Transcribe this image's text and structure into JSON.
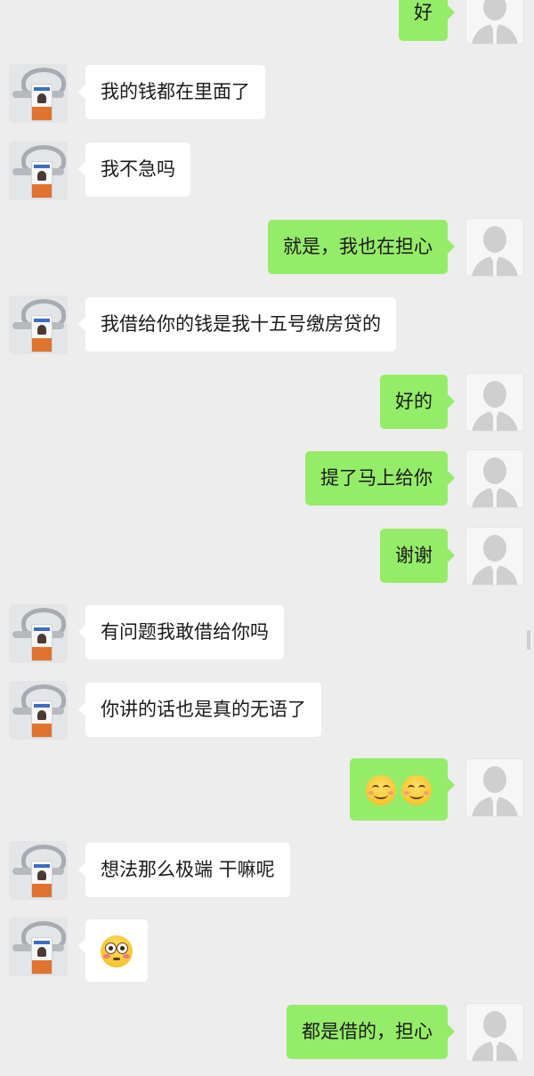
{
  "conversation": {
    "messages": [
      {
        "side": "right",
        "text": "好"
      },
      {
        "side": "left",
        "text": "我的钱都在里面了"
      },
      {
        "side": "left",
        "text": "我不急吗"
      },
      {
        "side": "right",
        "text": "就是，我也在担心"
      },
      {
        "side": "left",
        "text": "我借给你的钱是我十五号缴房贷的"
      },
      {
        "side": "right",
        "text": "好的"
      },
      {
        "side": "right",
        "text": "提了马上给你"
      },
      {
        "side": "right",
        "text": "谢谢"
      },
      {
        "side": "left",
        "text": "有问题我敢借给你吗"
      },
      {
        "side": "left",
        "text": "你讲的话也是真的无语了"
      },
      {
        "side": "right",
        "emoji": [
          "smiling-face-emoji",
          "smiling-face-emoji"
        ]
      },
      {
        "side": "left",
        "text": "想法那么极端 干嘛呢"
      },
      {
        "side": "left",
        "emoji": [
          "flushed-face-emoji"
        ]
      },
      {
        "side": "right",
        "text": "都是借的，担心"
      }
    ]
  },
  "colors": {
    "background": "#ededed",
    "self_bubble": "#95ec69",
    "other_bubble": "#ffffff",
    "text": "#1a1a1a"
  }
}
